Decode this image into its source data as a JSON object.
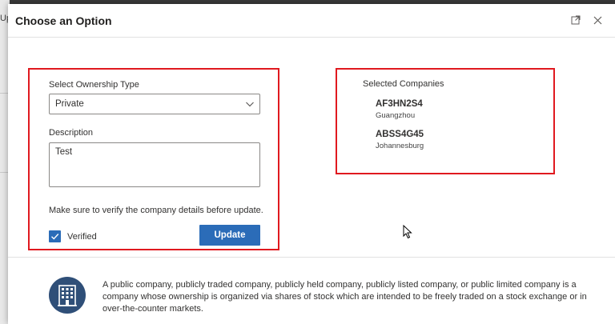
{
  "background": {
    "partial_text": "Up"
  },
  "dialog": {
    "title": "Choose an Option",
    "expand_icon": "expand-icon",
    "close_icon": "close-icon"
  },
  "form": {
    "ownership_label": "Select Ownership Type",
    "ownership_value": "Private",
    "description_label": "Description",
    "description_value": "Test",
    "note": "Make sure to verify the company details before update.",
    "verified_label": "Verified",
    "verified_checked": true,
    "update_label": "Update"
  },
  "selected": {
    "title": "Selected Companies",
    "companies": [
      {
        "code": "AF3HN2S4",
        "city": "Guangzhou"
      },
      {
        "code": "ABSS4G45",
        "city": "Johannesburg"
      }
    ]
  },
  "footer": {
    "icon": "building-icon",
    "text": "A public company, publicly traded company, publicly held company, publicly listed company, or public limited company is a company whose ownership is organized via shares of stock which are intended to be freely traded on a stock exchange or in over-the-counter markets."
  },
  "colors": {
    "accent": "#2b6cb8",
    "highlight_border": "#e0191f",
    "footer_icon_bg": "#2f4f78"
  }
}
